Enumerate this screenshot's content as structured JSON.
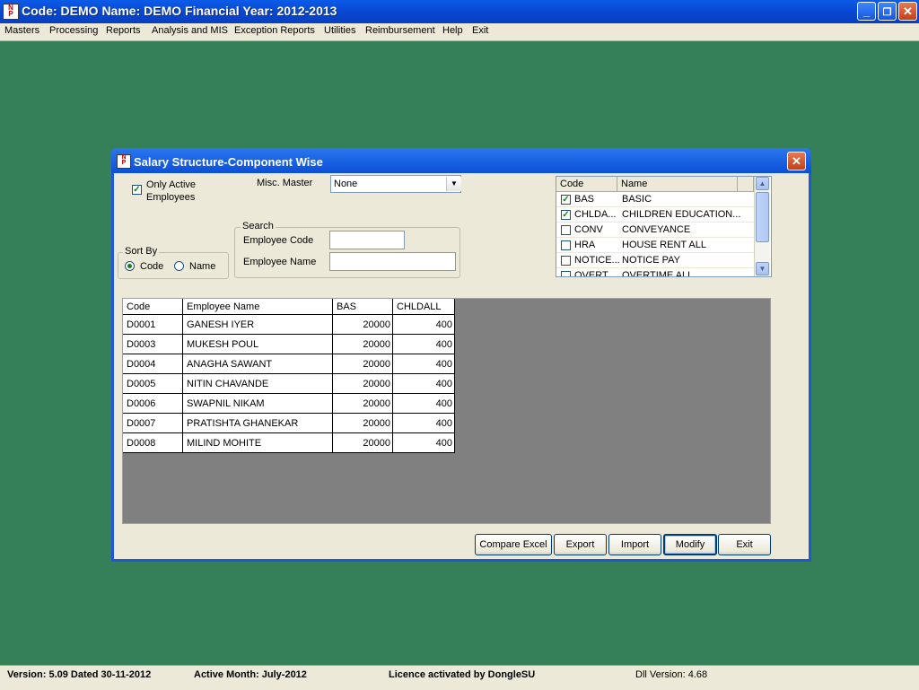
{
  "app": {
    "title": "Code: DEMO Name: DEMO Financial Year: 2012-2013",
    "icon_text": "Ng\nP"
  },
  "menu": [
    "Masters",
    "Processing",
    "Reports",
    "Analysis and MIS",
    "Exception Reports",
    "Utilities",
    "Reimbursement",
    "Help",
    "Exit"
  ],
  "dialog": {
    "title": "Salary Structure-Component Wise",
    "only_active": {
      "label_line1": "Only Active",
      "label_line2": "Employees",
      "checked": true
    },
    "misc_master": {
      "label": "Misc. Master",
      "value": "None"
    },
    "search": {
      "legend": "Search",
      "emp_code_label": "Employee Code",
      "emp_code_value": "",
      "emp_name_label": "Employee Name",
      "emp_name_value": ""
    },
    "sort_by": {
      "legend": "Sort By",
      "options": [
        "Code",
        "Name"
      ],
      "selected": "Code"
    },
    "components": {
      "headers": [
        "Code",
        "Name"
      ],
      "rows": [
        {
          "code": "BAS",
          "name": "BASIC",
          "checked": true
        },
        {
          "code": "CHLDA...",
          "name": "CHILDREN EDUCATION...",
          "checked": true
        },
        {
          "code": "CONV",
          "name": "CONVEYANCE",
          "checked": false
        },
        {
          "code": "HRA",
          "name": "HOUSE RENT ALL",
          "checked": false
        },
        {
          "code": "NOTICE...",
          "name": "NOTICE PAY",
          "checked": false
        },
        {
          "code": "OVERT...",
          "name": "OVERTIME ALL",
          "checked": false
        }
      ]
    },
    "grid": {
      "headers": [
        "Code",
        "Employee Name",
        "BAS",
        "CHLDALL"
      ],
      "rows": [
        [
          "D0001",
          "GANESH IYER",
          "20000",
          "400"
        ],
        [
          "D0003",
          "MUKESH POUL",
          "20000",
          "400"
        ],
        [
          "D0004",
          "ANAGHA SAWANT",
          "20000",
          "400"
        ],
        [
          "D0005",
          "NITIN CHAVANDE",
          "20000",
          "400"
        ],
        [
          "D0006",
          "SWAPNIL NIKAM",
          "20000",
          "400"
        ],
        [
          "D0007",
          "PRATISHTA GHANEKAR",
          "20000",
          "400"
        ],
        [
          "D0008",
          "MILIND MOHITE",
          "20000",
          "400"
        ]
      ]
    },
    "buttons": {
      "compare_excel": "Compare Excel",
      "export": "Export",
      "import": "Import",
      "modify": "Modify",
      "exit": "Exit"
    }
  },
  "status": {
    "version": "Version: 5.09 Dated 30-11-2012",
    "active_month": "Active Month: July-2012",
    "licence": "Licence activated by DongleSU",
    "dll_version": "Dll Version: 4.68"
  },
  "colors": {
    "desktop": "#357f59",
    "titlebar": "#0a5ce8",
    "dialog_face": "#ece9d8",
    "grid_empty": "#808080"
  }
}
